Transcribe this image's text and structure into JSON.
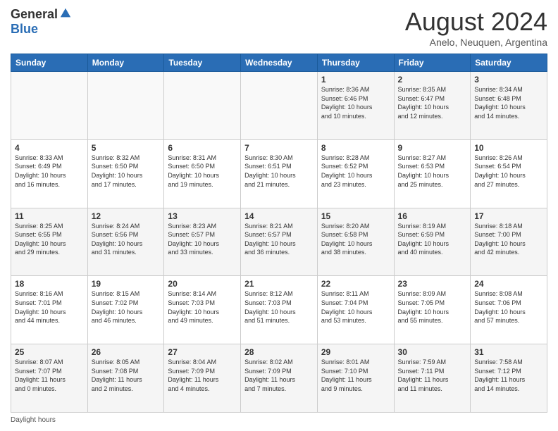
{
  "logo": {
    "general": "General",
    "blue": "Blue"
  },
  "header": {
    "title": "August 2024",
    "subtitle": "Anelo, Neuquen, Argentina"
  },
  "weekdays": [
    "Sunday",
    "Monday",
    "Tuesday",
    "Wednesday",
    "Thursday",
    "Friday",
    "Saturday"
  ],
  "weeks": [
    [
      {
        "day": "",
        "info": ""
      },
      {
        "day": "",
        "info": ""
      },
      {
        "day": "",
        "info": ""
      },
      {
        "day": "",
        "info": ""
      },
      {
        "day": "1",
        "info": "Sunrise: 8:36 AM\nSunset: 6:46 PM\nDaylight: 10 hours\nand 10 minutes."
      },
      {
        "day": "2",
        "info": "Sunrise: 8:35 AM\nSunset: 6:47 PM\nDaylight: 10 hours\nand 12 minutes."
      },
      {
        "day": "3",
        "info": "Sunrise: 8:34 AM\nSunset: 6:48 PM\nDaylight: 10 hours\nand 14 minutes."
      }
    ],
    [
      {
        "day": "4",
        "info": "Sunrise: 8:33 AM\nSunset: 6:49 PM\nDaylight: 10 hours\nand 16 minutes."
      },
      {
        "day": "5",
        "info": "Sunrise: 8:32 AM\nSunset: 6:50 PM\nDaylight: 10 hours\nand 17 minutes."
      },
      {
        "day": "6",
        "info": "Sunrise: 8:31 AM\nSunset: 6:50 PM\nDaylight: 10 hours\nand 19 minutes."
      },
      {
        "day": "7",
        "info": "Sunrise: 8:30 AM\nSunset: 6:51 PM\nDaylight: 10 hours\nand 21 minutes."
      },
      {
        "day": "8",
        "info": "Sunrise: 8:28 AM\nSunset: 6:52 PM\nDaylight: 10 hours\nand 23 minutes."
      },
      {
        "day": "9",
        "info": "Sunrise: 8:27 AM\nSunset: 6:53 PM\nDaylight: 10 hours\nand 25 minutes."
      },
      {
        "day": "10",
        "info": "Sunrise: 8:26 AM\nSunset: 6:54 PM\nDaylight: 10 hours\nand 27 minutes."
      }
    ],
    [
      {
        "day": "11",
        "info": "Sunrise: 8:25 AM\nSunset: 6:55 PM\nDaylight: 10 hours\nand 29 minutes."
      },
      {
        "day": "12",
        "info": "Sunrise: 8:24 AM\nSunset: 6:56 PM\nDaylight: 10 hours\nand 31 minutes."
      },
      {
        "day": "13",
        "info": "Sunrise: 8:23 AM\nSunset: 6:57 PM\nDaylight: 10 hours\nand 33 minutes."
      },
      {
        "day": "14",
        "info": "Sunrise: 8:21 AM\nSunset: 6:57 PM\nDaylight: 10 hours\nand 36 minutes."
      },
      {
        "day": "15",
        "info": "Sunrise: 8:20 AM\nSunset: 6:58 PM\nDaylight: 10 hours\nand 38 minutes."
      },
      {
        "day": "16",
        "info": "Sunrise: 8:19 AM\nSunset: 6:59 PM\nDaylight: 10 hours\nand 40 minutes."
      },
      {
        "day": "17",
        "info": "Sunrise: 8:18 AM\nSunset: 7:00 PM\nDaylight: 10 hours\nand 42 minutes."
      }
    ],
    [
      {
        "day": "18",
        "info": "Sunrise: 8:16 AM\nSunset: 7:01 PM\nDaylight: 10 hours\nand 44 minutes."
      },
      {
        "day": "19",
        "info": "Sunrise: 8:15 AM\nSunset: 7:02 PM\nDaylight: 10 hours\nand 46 minutes."
      },
      {
        "day": "20",
        "info": "Sunrise: 8:14 AM\nSunset: 7:03 PM\nDaylight: 10 hours\nand 49 minutes."
      },
      {
        "day": "21",
        "info": "Sunrise: 8:12 AM\nSunset: 7:03 PM\nDaylight: 10 hours\nand 51 minutes."
      },
      {
        "day": "22",
        "info": "Sunrise: 8:11 AM\nSunset: 7:04 PM\nDaylight: 10 hours\nand 53 minutes."
      },
      {
        "day": "23",
        "info": "Sunrise: 8:09 AM\nSunset: 7:05 PM\nDaylight: 10 hours\nand 55 minutes."
      },
      {
        "day": "24",
        "info": "Sunrise: 8:08 AM\nSunset: 7:06 PM\nDaylight: 10 hours\nand 57 minutes."
      }
    ],
    [
      {
        "day": "25",
        "info": "Sunrise: 8:07 AM\nSunset: 7:07 PM\nDaylight: 11 hours\nand 0 minutes."
      },
      {
        "day": "26",
        "info": "Sunrise: 8:05 AM\nSunset: 7:08 PM\nDaylight: 11 hours\nand 2 minutes."
      },
      {
        "day": "27",
        "info": "Sunrise: 8:04 AM\nSunset: 7:09 PM\nDaylight: 11 hours\nand 4 minutes."
      },
      {
        "day": "28",
        "info": "Sunrise: 8:02 AM\nSunset: 7:09 PM\nDaylight: 11 hours\nand 7 minutes."
      },
      {
        "day": "29",
        "info": "Sunrise: 8:01 AM\nSunset: 7:10 PM\nDaylight: 11 hours\nand 9 minutes."
      },
      {
        "day": "30",
        "info": "Sunrise: 7:59 AM\nSunset: 7:11 PM\nDaylight: 11 hours\nand 11 minutes."
      },
      {
        "day": "31",
        "info": "Sunrise: 7:58 AM\nSunset: 7:12 PM\nDaylight: 11 hours\nand 14 minutes."
      }
    ]
  ],
  "footer": {
    "daylight_label": "Daylight hours"
  }
}
